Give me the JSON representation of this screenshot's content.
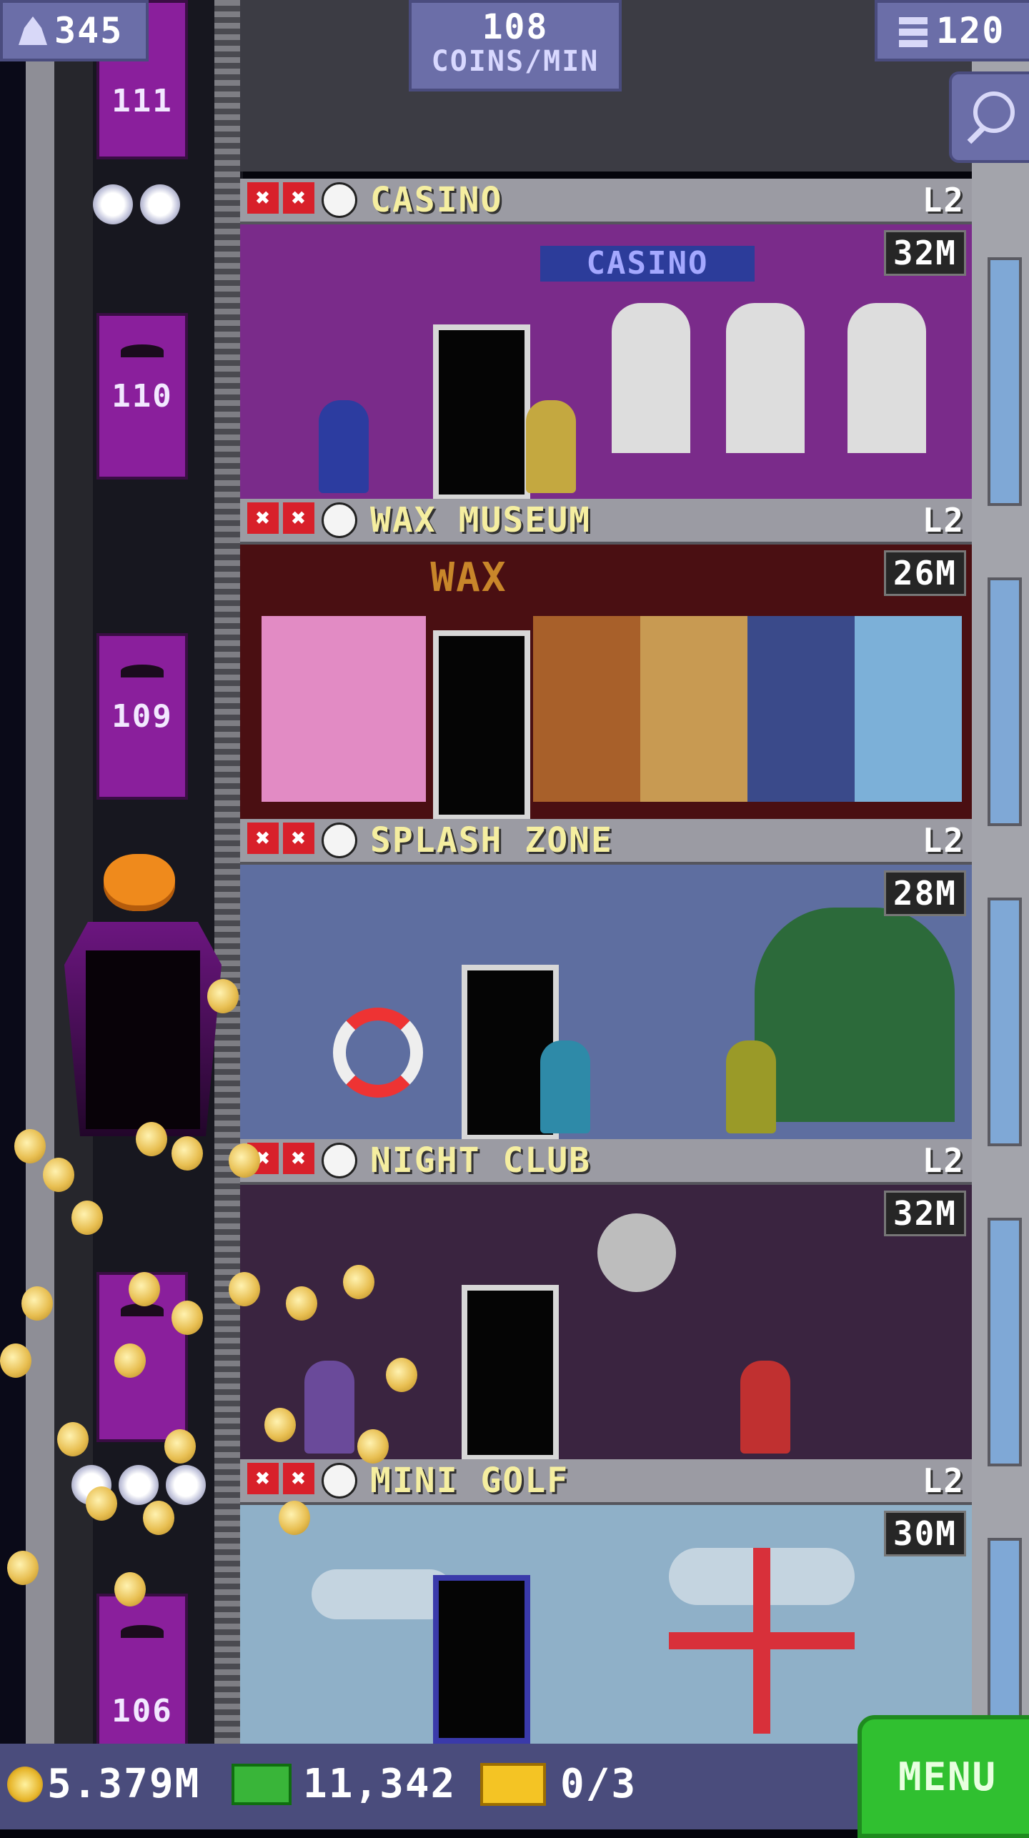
{
  "hud": {
    "population": "345",
    "coins_per_min_value": "108",
    "coins_per_min_unit": "COINS/MIN",
    "floors": "120"
  },
  "elevator": {
    "floor_labels": [
      "111",
      "110",
      "109",
      "106"
    ]
  },
  "floors": [
    {
      "name": "CASINO",
      "level": "L2",
      "earnings": "32M",
      "sign": "CASINO",
      "theme": "#7a2b8a"
    },
    {
      "name": "WAX MUSEUM",
      "level": "L2",
      "earnings": "26M",
      "sign": "WAX",
      "theme": "#4a0f12"
    },
    {
      "name": "SPLASH ZONE",
      "level": "L2",
      "earnings": "28M",
      "theme": "#5e6ea0"
    },
    {
      "name": "NIGHT CLUB",
      "level": "L2",
      "earnings": "32M",
      "theme": "#3a2440"
    },
    {
      "name": "MINI GOLF",
      "level": "L2",
      "earnings": "30M",
      "theme": "#8fb0c8"
    }
  ],
  "bottom": {
    "coins": "5.379M",
    "bux": "11,342",
    "tickets": "0/3",
    "menu_label": "MENU"
  },
  "colors": {
    "hud_bg": "#6b6ea8",
    "menu_green": "#30c030",
    "x_red": "#d8202a",
    "floor_title": "#f5eea0"
  }
}
